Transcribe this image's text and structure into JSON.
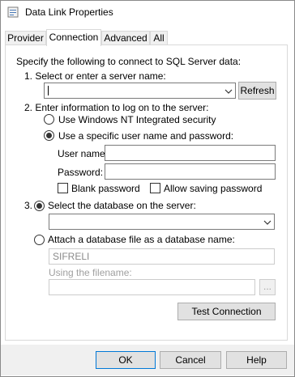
{
  "window": {
    "title": "Data Link Properties",
    "icon": "data-link-icon"
  },
  "tabs": [
    {
      "label": "Provider",
      "active": false
    },
    {
      "label": "Connection",
      "active": true
    },
    {
      "label": "Advanced",
      "active": false
    },
    {
      "label": "All",
      "active": false
    }
  ],
  "connection": {
    "intro": "Specify the following to connect to SQL Server data:",
    "step1_label": "1. Select or enter a server name:",
    "server_name_value": "",
    "refresh_label": "Refresh",
    "step2_label": "2. Enter information to log on to the server:",
    "auth_nt_label": "Use Windows NT Integrated security",
    "auth_sql_label": "Use a specific user name and password:",
    "auth_selected": "sql",
    "username_label": "User name:",
    "username_value": "",
    "password_label": "Password:",
    "password_value": "",
    "blank_password_label": "Blank password",
    "blank_password_checked": false,
    "allow_saving_label": "Allow saving password",
    "allow_saving_checked": false,
    "step3_prefix": "3.",
    "select_db_label": "Select the database on the server:",
    "database_value": "",
    "attach_db_label": "Attach a database file as a database name:",
    "db_source_selected": "select",
    "attach_name_value": "SIFRELI",
    "using_filename_label": "Using the filename:",
    "filename_value": "",
    "browse_label": "...",
    "test_connection_label": "Test Connection"
  },
  "footer": {
    "ok_label": "OK",
    "cancel_label": "Cancel",
    "help_label": "Help"
  }
}
